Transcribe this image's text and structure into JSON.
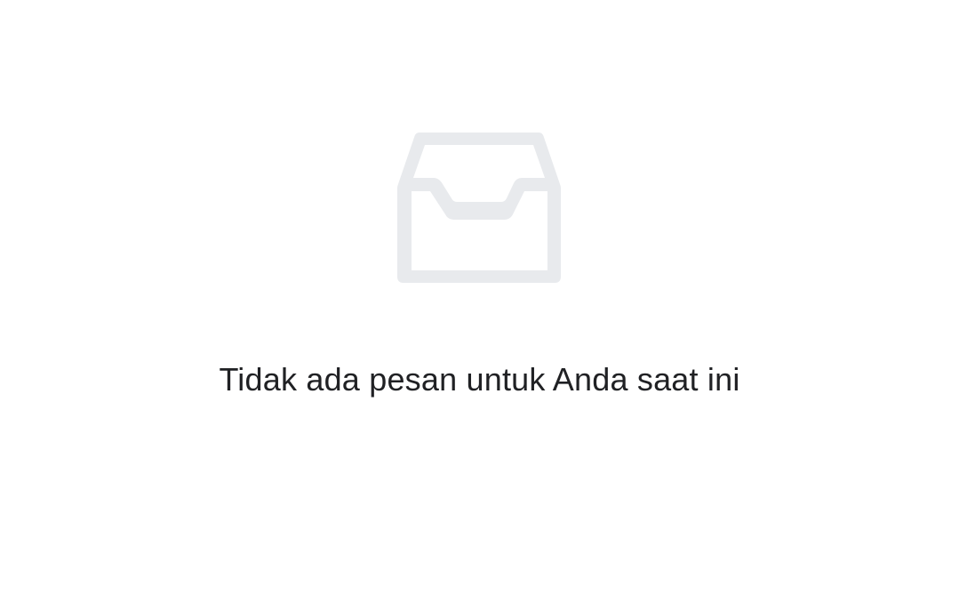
{
  "empty_state": {
    "icon": "inbox-icon",
    "icon_color": "#e8eaed",
    "message": "Tidak ada pesan untuk Anda saat ini",
    "message_color": "#202124",
    "background": "#ffffff"
  }
}
